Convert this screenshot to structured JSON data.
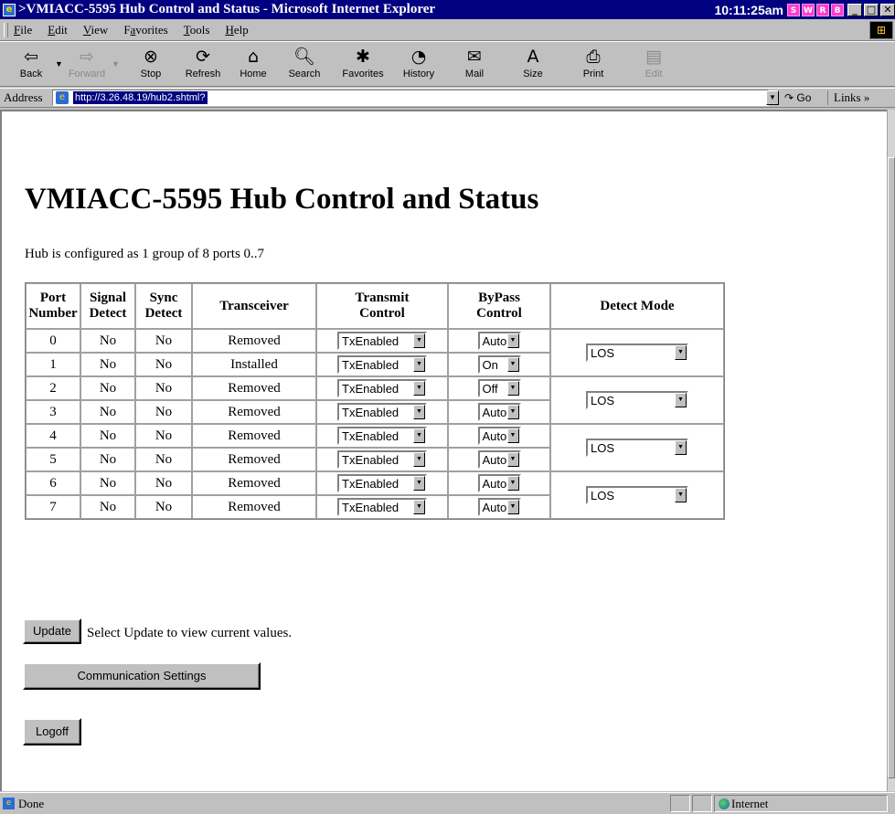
{
  "window": {
    "title": ">VMIACC-5595 Hub Control and Status - Microsoft Internet Explorer",
    "clock": "10:11:25am",
    "tray_badges": [
      "S",
      "W",
      "R",
      "B"
    ]
  },
  "menu": {
    "items": [
      {
        "u": "F",
        "rest": "ile"
      },
      {
        "u": "E",
        "rest": "dit"
      },
      {
        "u": "V",
        "rest": "iew"
      },
      {
        "pre": "F",
        "u": "a",
        "rest": "vorites"
      },
      {
        "u": "T",
        "rest": "ools"
      },
      {
        "u": "H",
        "rest": "elp"
      }
    ]
  },
  "toolbar": {
    "back": "Back",
    "forward": "Forward",
    "stop": "Stop",
    "refresh": "Refresh",
    "home": "Home",
    "search": "Search",
    "favorites": "Favorites",
    "history": "History",
    "mail": "Mail",
    "size": "Size",
    "print": "Print",
    "edit": "Edit"
  },
  "address": {
    "label": "Address",
    "url": "http://3.26.48.19/hub2.shtml?",
    "go": "Go",
    "links": "Links"
  },
  "page": {
    "title": "VMIACC-5595 Hub Control and Status",
    "config_text": "Hub is configured as 1 group of 8 ports 0..7",
    "headers": {
      "port_a": "Port",
      "port_b": "Number",
      "signal_a": "Signal",
      "signal_b": "Detect",
      "sync_a": "Sync",
      "sync_b": "Detect",
      "transceiver": "Transceiver",
      "transmit_a": "Transmit",
      "transmit_b": "Control",
      "bypass_a": "ByPass",
      "bypass_b": "Control",
      "detect_mode": "Detect Mode"
    },
    "rows": [
      {
        "port": "0",
        "signal": "No",
        "sync": "No",
        "transceiver": "Removed",
        "transmit": "TxEnabled",
        "bypass": "Auto"
      },
      {
        "port": "1",
        "signal": "No",
        "sync": "No",
        "transceiver": "Installed",
        "transmit": "TxEnabled",
        "bypass": "On"
      },
      {
        "port": "2",
        "signal": "No",
        "sync": "No",
        "transceiver": "Removed",
        "transmit": "TxEnabled",
        "bypass": "Off"
      },
      {
        "port": "3",
        "signal": "No",
        "sync": "No",
        "transceiver": "Removed",
        "transmit": "TxEnabled",
        "bypass": "Auto"
      },
      {
        "port": "4",
        "signal": "No",
        "sync": "No",
        "transceiver": "Removed",
        "transmit": "TxEnabled",
        "bypass": "Auto"
      },
      {
        "port": "5",
        "signal": "No",
        "sync": "No",
        "transceiver": "Removed",
        "transmit": "TxEnabled",
        "bypass": "Auto"
      },
      {
        "port": "6",
        "signal": "No",
        "sync": "No",
        "transceiver": "Removed",
        "transmit": "TxEnabled",
        "bypass": "Auto"
      },
      {
        "port": "7",
        "signal": "No",
        "sync": "No",
        "transceiver": "Removed",
        "transmit": "TxEnabled",
        "bypass": "Auto"
      }
    ],
    "detect_modes": [
      "LOS",
      "LOS",
      "LOS",
      "LOS"
    ],
    "update_button": "Update",
    "update_text": "Select Update to view current values.",
    "comm_button": "Communication Settings",
    "logoff_button": "Logoff"
  },
  "status": {
    "text": "Done",
    "zone": "Internet"
  },
  "colors": {
    "titlebar": "#000080",
    "chrome": "#c0c0c0",
    "tray_badge": "#ff3ccf"
  }
}
